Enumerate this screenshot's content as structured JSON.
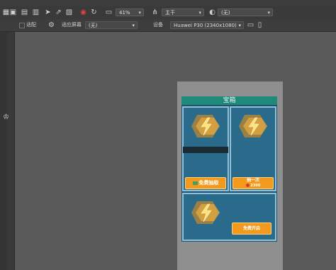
{
  "menubar": {
    "help_label": "帮助"
  },
  "toolbar": {
    "zoom": "41%",
    "root_node": "主干",
    "language": "(无)"
  },
  "toolbar2": {
    "adapt_label": "适配",
    "screen_label": "适应屏幕",
    "screen_value": "(无)",
    "device_label": "设备",
    "device_value": "Huawei P30 (2340x1080)"
  },
  "chest_panel": {
    "title": "宝箱",
    "free_draw_label": "免费抽取",
    "buy_one_label": "抽一次",
    "buy_one_price": "2300",
    "free_open_label": "免费开启"
  },
  "colors": {
    "title_bar": "#1e8a7a",
    "panel_bg": "#22506e",
    "card_border": "#8fc2d8",
    "button": "#f39a1e"
  }
}
